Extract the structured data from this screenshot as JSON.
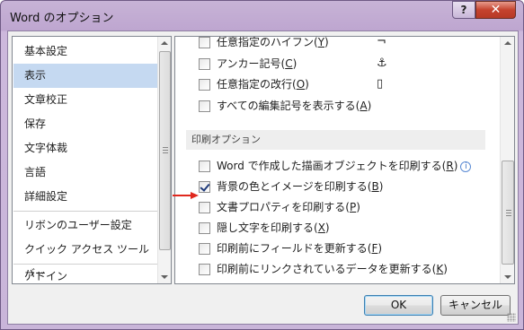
{
  "window": {
    "title": "Word のオプション",
    "help_label": "?",
    "close_label": "✕"
  },
  "nav": {
    "items": [
      {
        "label": "基本設定"
      },
      {
        "label": "表示",
        "selected": true
      },
      {
        "label": "文章校正"
      },
      {
        "label": "保存"
      },
      {
        "label": "文字体裁"
      },
      {
        "label": "言語"
      },
      {
        "label": "詳細設定"
      },
      {
        "label": "リボンのユーザー設定"
      },
      {
        "label": "クイック アクセス ツール バー"
      },
      {
        "label": "アドイン"
      }
    ]
  },
  "content": {
    "top_rows": [
      {
        "label": "任意指定のハイフン(",
        "key": "Y",
        "suffix": ")",
        "icon": "¬",
        "icon_name": "optional-hyphen-icon",
        "checked": false
      },
      {
        "label": "アンカー記号(",
        "key": "C",
        "suffix": ")",
        "icon": "⚓",
        "icon_name": "anchor-icon",
        "checked": false
      },
      {
        "label": "任意指定の改行(",
        "key": "O",
        "suffix": ")",
        "icon": "▯",
        "icon_name": "optional-break-icon",
        "checked": false
      },
      {
        "label": "すべての編集記号を表示する(",
        "key": "A",
        "suffix": ")",
        "checked": false
      }
    ],
    "section_title": "印刷オプション",
    "print_rows": [
      {
        "label": "Word で作成した描画オブジェクトを印刷する(",
        "key": "R",
        "suffix": ")",
        "checked": false,
        "info": true
      },
      {
        "label": "背景の色とイメージを印刷する(",
        "key": "B",
        "suffix": ")",
        "checked": true
      },
      {
        "label": "文書プロパティを印刷する(",
        "key": "P",
        "suffix": ")",
        "checked": false
      },
      {
        "label": "隠し文字を印刷する(",
        "key": "X",
        "suffix": ")",
        "checked": false
      },
      {
        "label": "印刷前にフィールドを更新する(",
        "key": "F",
        "suffix": ")",
        "checked": false
      },
      {
        "label": "印刷前にリンクされているデータを更新する(",
        "key": "K",
        "suffix": ")",
        "checked": false
      }
    ],
    "info_label": "i"
  },
  "buttons": {
    "ok_label": "OK",
    "cancel_label": "キャンセル"
  },
  "colors": {
    "selected_nav": "#c5d9f1",
    "annotation_arrow": "#e0281e"
  }
}
